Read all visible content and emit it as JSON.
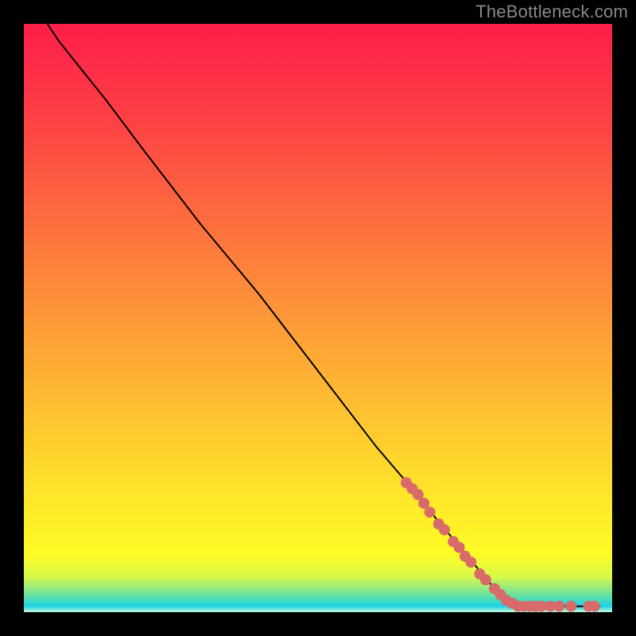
{
  "attribution": "TheBottleneck.com",
  "colors": {
    "background": "#000000",
    "curve": "#000000",
    "marker_fill": "#d96a6a",
    "marker_stroke": "#8b3a3a",
    "attribution_text": "#888888"
  },
  "chart_data": {
    "type": "line",
    "title": "",
    "xlabel": "",
    "ylabel": "",
    "xlim": [
      0,
      100
    ],
    "ylim": [
      0,
      100
    ],
    "grid": false,
    "curve": [
      {
        "x": 4,
        "y": 100
      },
      {
        "x": 6,
        "y": 97
      },
      {
        "x": 10,
        "y": 92
      },
      {
        "x": 14,
        "y": 87
      },
      {
        "x": 20,
        "y": 79
      },
      {
        "x": 30,
        "y": 66
      },
      {
        "x": 40,
        "y": 54
      },
      {
        "x": 50,
        "y": 41
      },
      {
        "x": 60,
        "y": 28
      },
      {
        "x": 66,
        "y": 21
      },
      {
        "x": 70,
        "y": 16
      },
      {
        "x": 75,
        "y": 10
      },
      {
        "x": 80,
        "y": 4
      },
      {
        "x": 82,
        "y": 2
      },
      {
        "x": 84,
        "y": 1
      },
      {
        "x": 86,
        "y": 1
      },
      {
        "x": 90,
        "y": 1
      },
      {
        "x": 95,
        "y": 1
      },
      {
        "x": 98,
        "y": 1
      }
    ],
    "marker_clusters": [
      {
        "x": 65,
        "y": 22
      },
      {
        "x": 66,
        "y": 21
      },
      {
        "x": 67,
        "y": 20
      },
      {
        "x": 68,
        "y": 18.5
      },
      {
        "x": 69,
        "y": 17
      },
      {
        "x": 70.5,
        "y": 15
      },
      {
        "x": 71.5,
        "y": 14
      },
      {
        "x": 73,
        "y": 12
      },
      {
        "x": 74,
        "y": 11
      },
      {
        "x": 75,
        "y": 9.5
      },
      {
        "x": 76,
        "y": 8.5
      },
      {
        "x": 77.5,
        "y": 6.5
      },
      {
        "x": 78.5,
        "y": 5.5
      },
      {
        "x": 80,
        "y": 4
      },
      {
        "x": 81,
        "y": 3
      },
      {
        "x": 82,
        "y": 2
      },
      {
        "x": 83,
        "y": 1.5
      },
      {
        "x": 84,
        "y": 1
      },
      {
        "x": 85,
        "y": 1
      },
      {
        "x": 86,
        "y": 1
      },
      {
        "x": 87,
        "y": 1
      },
      {
        "x": 88,
        "y": 1
      },
      {
        "x": 89.5,
        "y": 1
      },
      {
        "x": 91,
        "y": 1
      },
      {
        "x": 93,
        "y": 1
      },
      {
        "x": 96,
        "y": 1
      },
      {
        "x": 97,
        "y": 1
      }
    ]
  }
}
